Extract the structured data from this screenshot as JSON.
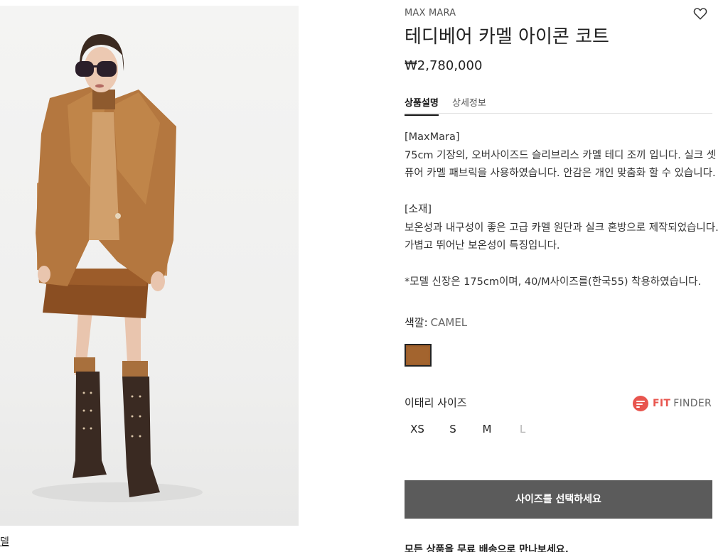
{
  "photo": {
    "caption": "델"
  },
  "product": {
    "brand": "MAX MARA",
    "title": "테디베어 카멜 아이콘 코트",
    "price": "₩2,780,000"
  },
  "tabs": [
    {
      "label": "상품설명",
      "active": true
    },
    {
      "label": "상세정보",
      "active": false
    }
  ],
  "description": {
    "paragraph_1": [
      " [MaxMara]",
      "75cm 기장의, 오버사이즈드 슬리브리스 카멜 테디 조끼 입니다. 실크 셋",
      "퓨어 카멜 패브릭을 사용하였습니다. 안감은 개인 맞춤화 할 수 있습니다."
    ],
    "paragraph_2": [
      " [소재]",
      "보온성과 내구성이 좋은 고급 카멜 원단과 실크 혼방으로 제작되었습니다.",
      "가볍고 뛰어난 보온성이 특징입니다."
    ],
    "paragraph_3": [
      "*모델 신장은 175cm이며, 40/M사이즈를(한국55) 착용하였습니다."
    ]
  },
  "color": {
    "label": "색깔:",
    "value": "CAMEL",
    "swatch_hex": "#a3642e"
  },
  "size": {
    "title": "이태리 사이즈",
    "fit_finder_brand": "FIT",
    "fit_finder_word": "FINDER",
    "fit_finder_color": "#e8554e",
    "options": [
      {
        "label": "XS",
        "available": true
      },
      {
        "label": "S",
        "available": true
      },
      {
        "label": "M",
        "available": true
      },
      {
        "label": "L",
        "available": false
      }
    ]
  },
  "cta": {
    "label": "사이즈를 선택하세요"
  },
  "shipping": {
    "text": "모든 상품을 무료 배송으로 만나보세요."
  },
  "icons": {
    "wishlist": "heart-icon",
    "fit_finder": "fit-finder-icon"
  }
}
